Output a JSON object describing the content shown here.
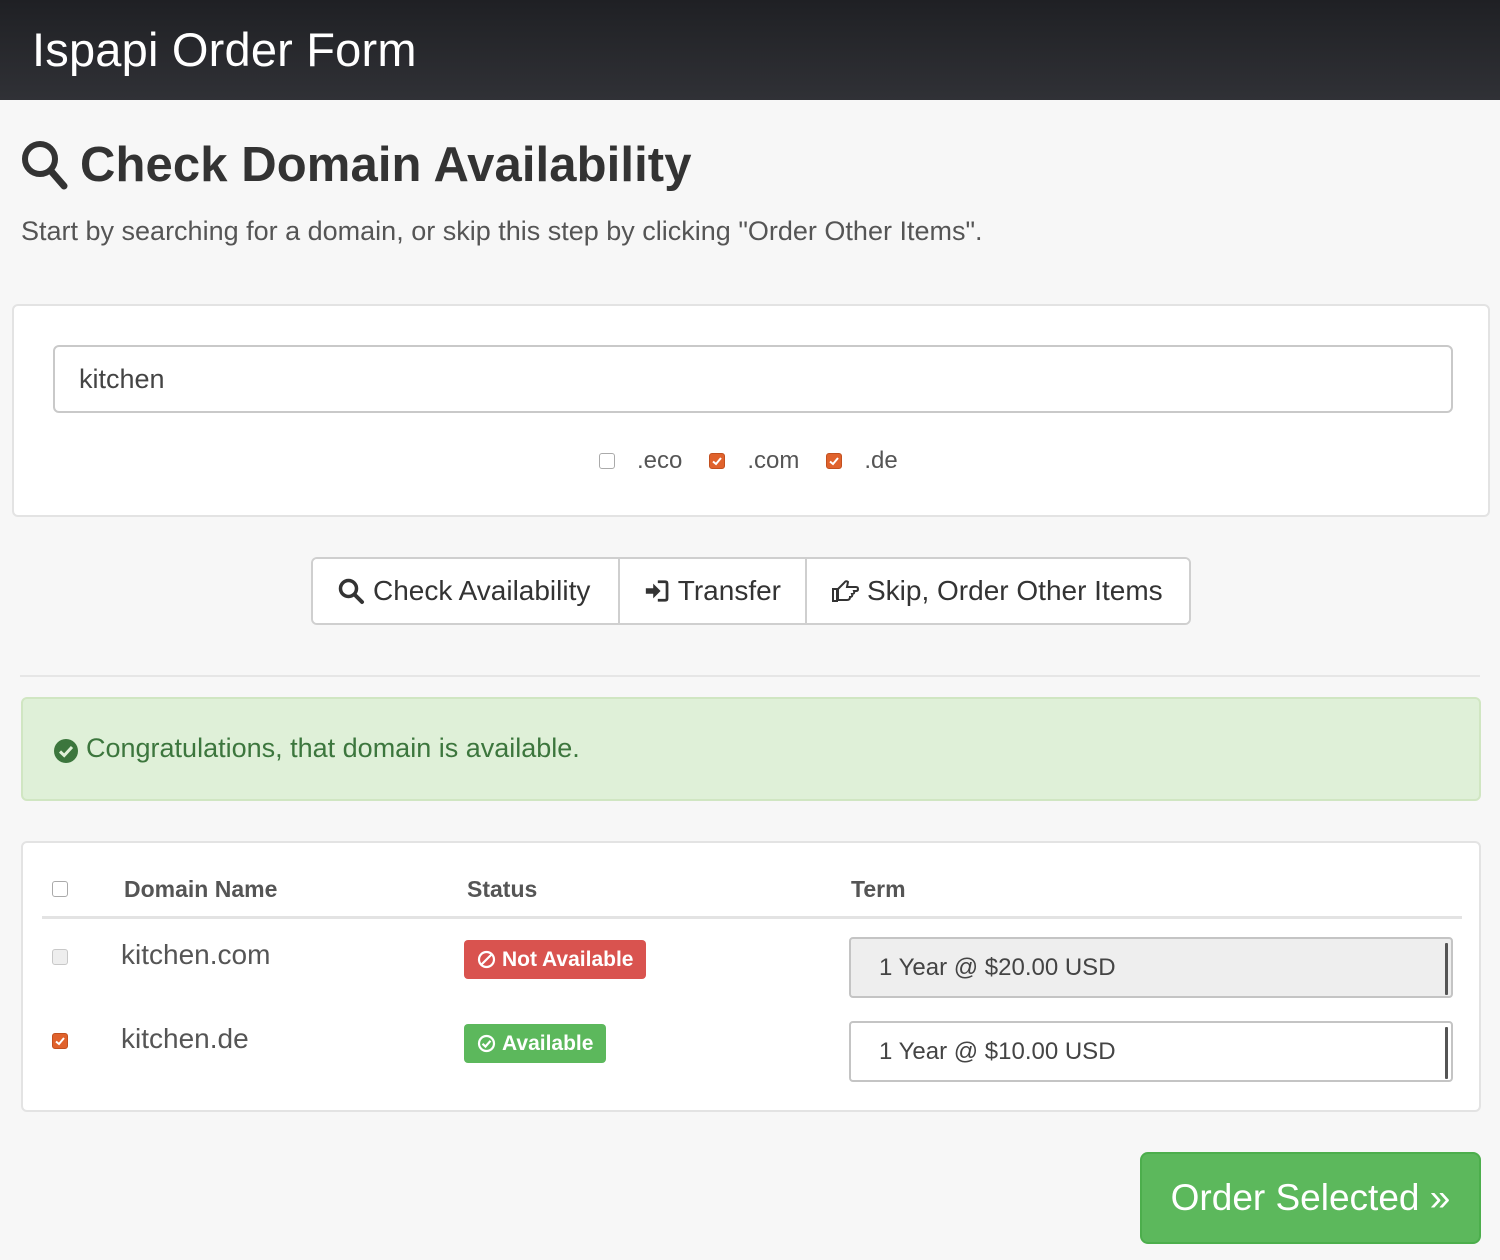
{
  "navbar": {
    "brand": "Ispapi Order Form"
  },
  "page": {
    "title": "Check Domain Availability",
    "intro": "Start by searching for a domain, or skip this step by clicking \"Order Other Items\"."
  },
  "search": {
    "value": "kitchen",
    "tlds": [
      {
        "label": ".eco",
        "checked": false
      },
      {
        "label": ".com",
        "checked": true
      },
      {
        "label": ".de",
        "checked": true
      }
    ]
  },
  "buttons": {
    "check": "Check Availability",
    "transfer": "Transfer",
    "skip": "Skip, Order Other Items"
  },
  "alert": {
    "text": "Congratulations, that domain is available."
  },
  "results": {
    "headers": {
      "domain": "Domain Name",
      "status": "Status",
      "term": "Term"
    },
    "rows": [
      {
        "domain": "kitchen.com",
        "status": "Not Available",
        "term": "1 Year @ $20.00 USD",
        "checked": false,
        "enabled": false
      },
      {
        "domain": "kitchen.de",
        "status": "Available",
        "term": "1 Year @ $10.00 USD",
        "checked": true,
        "enabled": true
      }
    ]
  },
  "order_button": "Order Selected »",
  "colors": {
    "navbar": "#26272b",
    "accent_checkbox": "#e0622c",
    "success": "#5cb85c",
    "danger": "#d9534f",
    "alert_bg": "#dff0d8",
    "alert_text": "#3c763d"
  }
}
